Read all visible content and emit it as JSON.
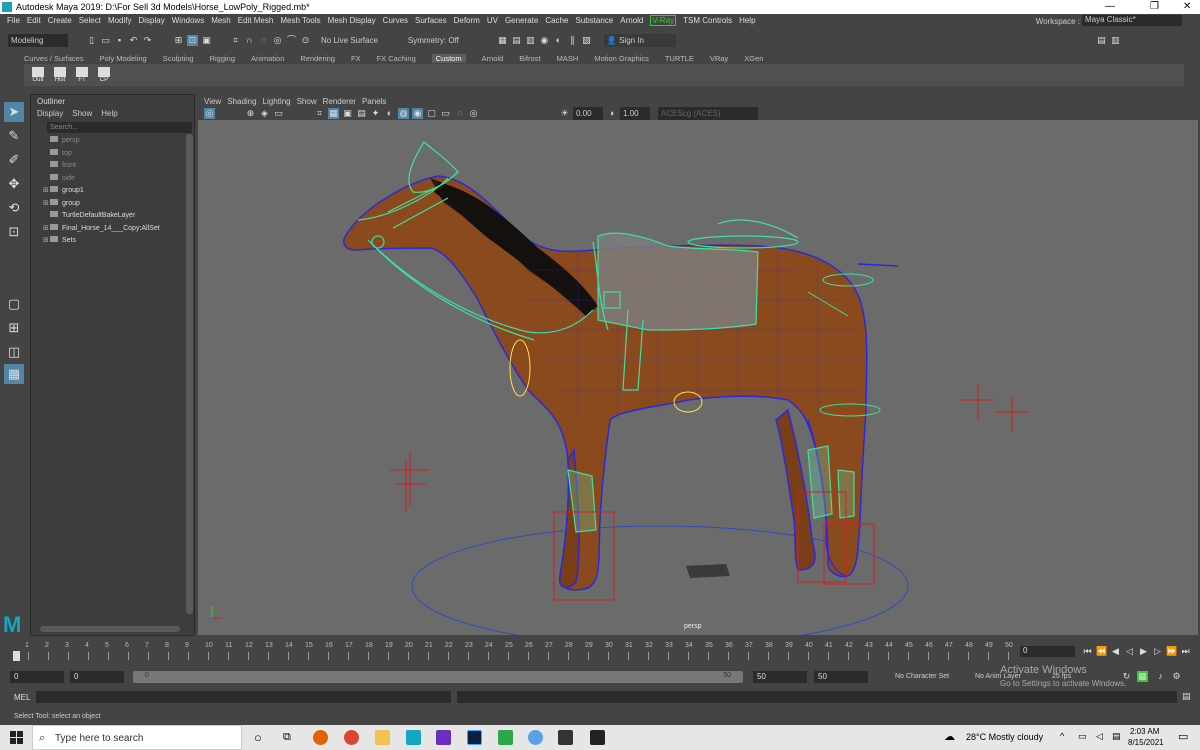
{
  "window": {
    "title": "Autodesk Maya 2019: D:\\For Sell 3d Models\\Horse_LowPoly_Rigged.mb*"
  },
  "menubar": [
    "File",
    "Edit",
    "Create",
    "Select",
    "Modify",
    "Display",
    "Windows",
    "Mesh",
    "Edit Mesh",
    "Mesh Tools",
    "Mesh Display",
    "Curves",
    "Surfaces",
    "Deform",
    "UV",
    "Generate",
    "Cache",
    "Substance",
    "Arnold"
  ],
  "menubar_extra": {
    "vray": "V-Ray",
    "tsm": "TSM Controls",
    "help": "Help"
  },
  "workspace": {
    "label": "Workspace :",
    "value": "Maya Classic*"
  },
  "statusline": {
    "mode": "Modeling",
    "live_surface": "No Live Surface",
    "symmetry": "Symmetry: Off",
    "sign_in": "Sign In"
  },
  "shelf_tabs": [
    "Curves / Surfaces",
    "Poly Modeling",
    "Sculpting",
    "Rigging",
    "Animation",
    "Rendering",
    "FX",
    "FX Caching",
    "Custom",
    "Arnold",
    "Bifrost",
    "MASH",
    "Motion Graphics",
    "TURTLE",
    "VRay",
    "XGen"
  ],
  "shelf_active": "Custom",
  "shelf_buttons": [
    "Outl",
    "Hist",
    "FT",
    "CP"
  ],
  "outliner": {
    "title": "Outliner",
    "menus": [
      "Display",
      "Show",
      "Help"
    ],
    "search_placeholder": "Search...",
    "items": [
      {
        "label": "persp",
        "dim": true,
        "expandable": false
      },
      {
        "label": "top",
        "dim": true,
        "expandable": false
      },
      {
        "label": "front",
        "dim": true,
        "expandable": false
      },
      {
        "label": "side",
        "dim": true,
        "expandable": false
      },
      {
        "label": "group1",
        "dim": false,
        "expandable": true
      },
      {
        "label": "group",
        "dim": false,
        "expandable": true
      },
      {
        "label": "TurtleDefaultBakeLayer",
        "dim": false,
        "expandable": false
      },
      {
        "label": "Final_Horse_14___Copy:AllSet",
        "dim": false,
        "expandable": true
      },
      {
        "label": "Sets",
        "dim": false,
        "expandable": true
      }
    ]
  },
  "viewport": {
    "menus": [
      "View",
      "Shading",
      "Lighting",
      "Show",
      "Renderer",
      "Panels"
    ],
    "exposure": "0.00",
    "gamma": "1.00",
    "color_space": "ACEScg (ACES)",
    "camera_label": "persp"
  },
  "timeline": {
    "ticks": [
      1,
      2,
      3,
      4,
      5,
      6,
      7,
      8,
      9,
      10,
      11,
      12,
      13,
      14,
      15,
      16,
      17,
      18,
      19,
      20,
      21,
      22,
      23,
      24,
      25,
      26,
      27,
      28,
      29,
      30,
      31,
      32,
      33,
      34,
      35,
      36,
      37,
      38,
      39,
      40,
      41,
      42,
      43,
      44,
      45,
      46,
      47,
      48,
      49,
      50
    ],
    "current_frame": "0"
  },
  "range": {
    "start": "0",
    "inner_start": "0",
    "slider_start": "0",
    "slider_end": "50",
    "inner_end": "50",
    "end": "50",
    "character_set": "No Character Set",
    "anim_layer": "No Anim Layer",
    "fps": "25 fps"
  },
  "cmdline": {
    "label": "MEL"
  },
  "helpline": {
    "text": "Select Tool: select an object"
  },
  "watermark": {
    "line1": "Activate Windows",
    "line2": "Go to Settings to activate Windows."
  },
  "taskbar": {
    "search": "Type here to search",
    "weather": "28°C  Mostly cloudy",
    "time": "2:03 AM",
    "date": "8/15/2021"
  }
}
